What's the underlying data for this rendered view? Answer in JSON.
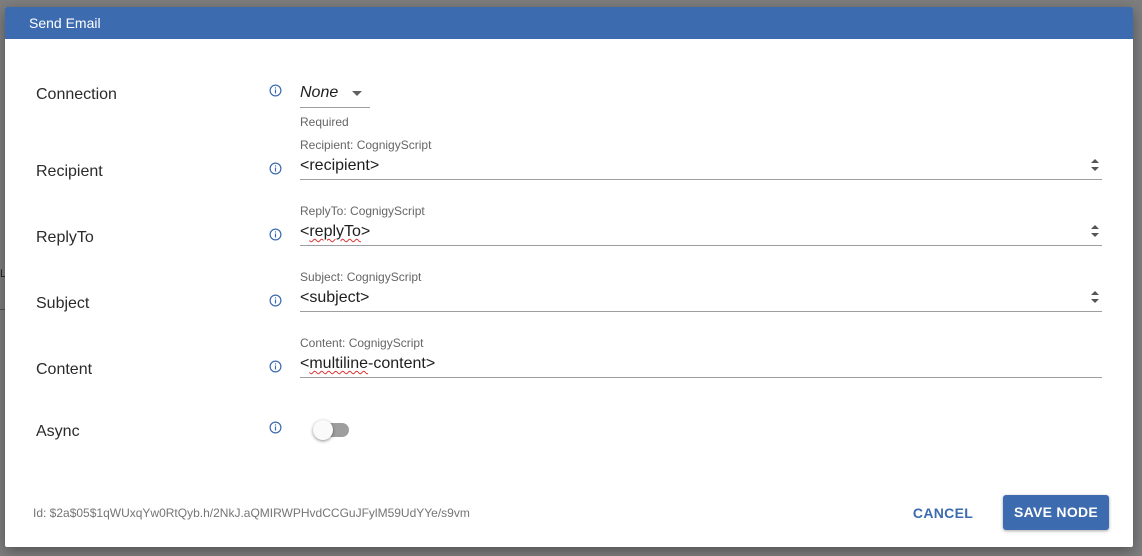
{
  "background": {
    "edge_glyph": "L"
  },
  "dialog": {
    "title": "Send Email",
    "header_color": "#3d6bb0"
  },
  "fields": {
    "connection": {
      "label": "Connection",
      "value": "None",
      "helper": "Required",
      "icon": "info-icon"
    },
    "recipient": {
      "label": "Recipient",
      "caption": "Recipient: CognigyScript",
      "value": "<recipient>",
      "icon": "info-icon"
    },
    "replyto": {
      "label": "ReplyTo",
      "caption": "ReplyTo: CognigyScript",
      "value_prefix": "<",
      "value_marked": "replyTo",
      "value_suffix": ">",
      "icon": "info-icon"
    },
    "subject": {
      "label": "Subject",
      "caption": "Subject: CognigyScript",
      "value": "<subject>",
      "icon": "info-icon"
    },
    "content": {
      "label": "Content",
      "caption": "Content: CognigyScript",
      "value_prefix": "<",
      "value_marked": "multiline",
      "value_suffix": "-content>",
      "icon": "info-icon"
    },
    "async": {
      "label": "Async",
      "enabled": false,
      "icon": "info-icon"
    }
  },
  "footer": {
    "node_id": "Id: $2a$05$1qWUxqYw0RtQyb.h/2NkJ.aQMIRWPHvdCCGuJFylM59UdYYe/s9vm",
    "cancel_label": "CANCEL",
    "save_label": "SAVE NODE"
  }
}
